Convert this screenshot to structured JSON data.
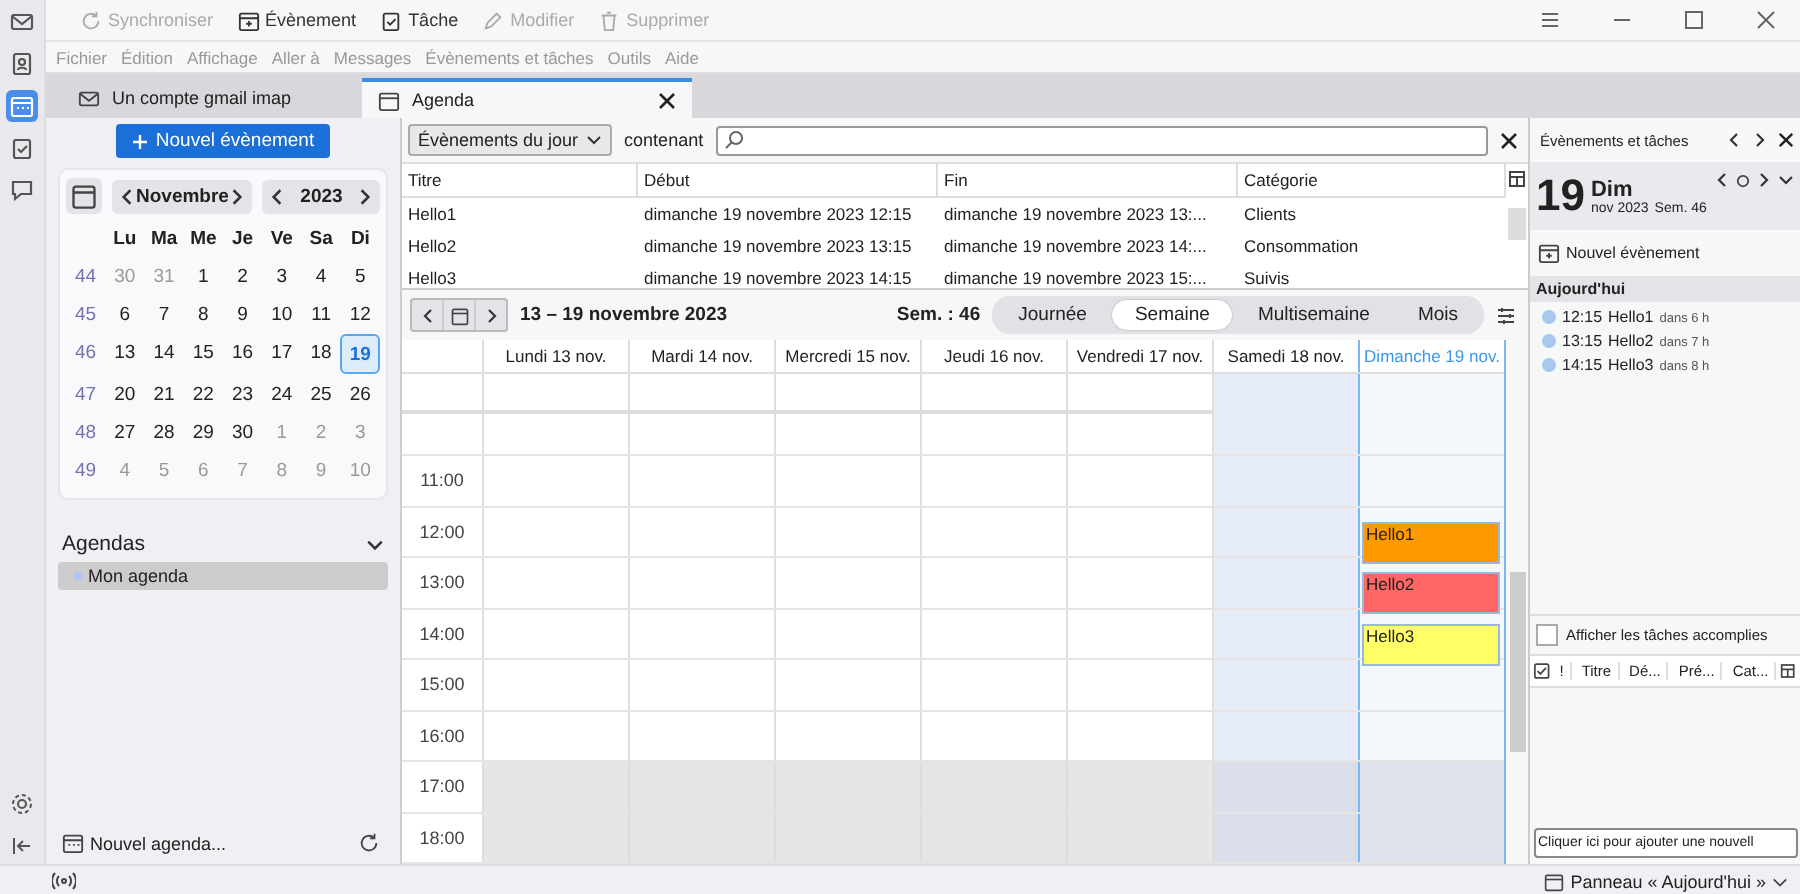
{
  "toolbar": [
    {
      "label": "Synchroniser",
      "disabled": true
    },
    {
      "label": "Évènement",
      "disabled": false
    },
    {
      "label": "Tâche",
      "disabled": false
    },
    {
      "label": "Modifier",
      "disabled": true
    },
    {
      "label": "Supprimer",
      "disabled": true
    }
  ],
  "menu": [
    "Fichier",
    "Édition",
    "Affichage",
    "Aller à",
    "Messages",
    "Évènements et tâches",
    "Outils",
    "Aide"
  ],
  "spaces": [
    {
      "selected": false
    },
    {
      "selected": false
    },
    {
      "selected": true
    },
    {
      "selected": false
    },
    {
      "selected": false
    }
  ],
  "tabs": [
    {
      "label": "Un compte gmail imap",
      "selected": false
    },
    {
      "label": "Agenda",
      "selected": true
    }
  ],
  "new_event_button": "Nouvel évènement",
  "mini_calendar": {
    "month": "Novembre",
    "year": "2023",
    "weekdays": [
      "Lu",
      "Ma",
      "Me",
      "Je",
      "Ve",
      "Sa",
      "Di"
    ],
    "weeks": [
      {
        "number": "44",
        "days": [
          {
            "label": "30",
            "other_month": true,
            "selected": false
          },
          {
            "label": "31",
            "other_month": true,
            "selected": false
          },
          {
            "label": "1",
            "other_month": false,
            "selected": false
          },
          {
            "label": "2",
            "other_month": false,
            "selected": false
          },
          {
            "label": "3",
            "other_month": false,
            "selected": false
          },
          {
            "label": "4",
            "other_month": false,
            "selected": false
          },
          {
            "label": "5",
            "other_month": false,
            "selected": false
          }
        ]
      },
      {
        "number": "45",
        "days": [
          {
            "label": "6",
            "other_month": false,
            "selected": false
          },
          {
            "label": "7",
            "other_month": false,
            "selected": false
          },
          {
            "label": "8",
            "other_month": false,
            "selected": false
          },
          {
            "label": "9",
            "other_month": false,
            "selected": false
          },
          {
            "label": "10",
            "other_month": false,
            "selected": false
          },
          {
            "label": "11",
            "other_month": false,
            "selected": false
          },
          {
            "label": "12",
            "other_month": false,
            "selected": false
          }
        ]
      },
      {
        "number": "46",
        "days": [
          {
            "label": "13",
            "other_month": false,
            "selected": false
          },
          {
            "label": "14",
            "other_month": false,
            "selected": false
          },
          {
            "label": "15",
            "other_month": false,
            "selected": false
          },
          {
            "label": "16",
            "other_month": false,
            "selected": false
          },
          {
            "label": "17",
            "other_month": false,
            "selected": false
          },
          {
            "label": "18",
            "other_month": false,
            "selected": false
          },
          {
            "label": "19",
            "other_month": false,
            "selected": true
          }
        ]
      },
      {
        "number": "47",
        "days": [
          {
            "label": "20",
            "other_month": false,
            "selected": false
          },
          {
            "label": "21",
            "other_month": false,
            "selected": false
          },
          {
            "label": "22",
            "other_month": false,
            "selected": false
          },
          {
            "label": "23",
            "other_month": false,
            "selected": false
          },
          {
            "label": "24",
            "other_month": false,
            "selected": false
          },
          {
            "label": "25",
            "other_month": false,
            "selected": false
          },
          {
            "label": "26",
            "other_month": false,
            "selected": false
          }
        ]
      },
      {
        "number": "48",
        "days": [
          {
            "label": "27",
            "other_month": false,
            "selected": false
          },
          {
            "label": "28",
            "other_month": false,
            "selected": false
          },
          {
            "label": "29",
            "other_month": false,
            "selected": false
          },
          {
            "label": "30",
            "other_month": false,
            "selected": false
          },
          {
            "label": "1",
            "other_month": true,
            "selected": false
          },
          {
            "label": "2",
            "other_month": true,
            "selected": false
          },
          {
            "label": "3",
            "other_month": true,
            "selected": false
          }
        ]
      },
      {
        "number": "49",
        "days": [
          {
            "label": "4",
            "other_month": true,
            "selected": false
          },
          {
            "label": "5",
            "other_month": true,
            "selected": false
          },
          {
            "label": "6",
            "other_month": true,
            "selected": false
          },
          {
            "label": "7",
            "other_month": true,
            "selected": false
          },
          {
            "label": "8",
            "other_month": true,
            "selected": false
          },
          {
            "label": "9",
            "other_month": true,
            "selected": false
          },
          {
            "label": "10",
            "other_month": true,
            "selected": false
          }
        ]
      }
    ]
  },
  "agendas": {
    "title": "Agendas",
    "items": [
      {
        "label": "Mon agenda",
        "selected": true,
        "color": "#a8c8f0"
      }
    ],
    "new_button": "Nouvel agenda..."
  },
  "filter": {
    "dropdown": "Évènements du jour",
    "label": "contenant"
  },
  "event_list": {
    "columns": [
      "Titre",
      "Début",
      "Fin",
      "Catégorie"
    ],
    "rows": [
      [
        "Hello1",
        "dimanche 19 novembre 2023 12:15",
        "dimanche 19 novembre 2023 13:...",
        "Clients"
      ],
      [
        "Hello2",
        "dimanche 19 novembre 2023 13:15",
        "dimanche 19 novembre 2023 14:...",
        "Consommation"
      ],
      [
        "Hello3",
        "dimanche 19 novembre 2023 14:15",
        "dimanche 19 novembre 2023 15:...",
        "Suivis"
      ]
    ]
  },
  "week_view": {
    "range": "13 – 19 novembre 2023",
    "week_label": "Sem. : 46",
    "views": [
      {
        "label": "Journée",
        "selected": false
      },
      {
        "label": "Semaine",
        "selected": true
      },
      {
        "label": "Multisemaine",
        "selected": false
      },
      {
        "label": "Mois",
        "selected": false
      }
    ],
    "days": [
      {
        "label": "Lundi 13 nov.",
        "weekend": false,
        "today": false
      },
      {
        "label": "Mardi 14 nov.",
        "weekend": false,
        "today": false
      },
      {
        "label": "Mercredi 15 nov.",
        "weekend": false,
        "today": false
      },
      {
        "label": "Jeudi 16 nov.",
        "weekend": false,
        "today": false
      },
      {
        "label": "Vendredi 17 nov.",
        "weekend": false,
        "today": false
      },
      {
        "label": "Samedi 18 nov.",
        "weekend": true,
        "today": false
      },
      {
        "label": "Dimanche 19 nov.",
        "weekend": true,
        "today": true
      }
    ],
    "hours": [
      {
        "off_hours": false
      },
      {
        "label": "11:00",
        "off_hours": false
      },
      {
        "label": "12:00",
        "off_hours": false,
        "events": [
          {
            "title": "Hello1",
            "color": "#ff9900"
          }
        ]
      },
      {
        "label": "13:00",
        "off_hours": false,
        "events": [
          {
            "title": "Hello2",
            "color": "#ff6666"
          }
        ]
      },
      {
        "label": "14:00",
        "off_hours": false,
        "events": [
          {
            "title": "Hello3",
            "color": "#ffff66"
          }
        ]
      },
      {
        "label": "15:00",
        "off_hours": false
      },
      {
        "label": "16:00",
        "off_hours": false
      },
      {
        "label": "17:00",
        "off_hours": true
      },
      {
        "label": "18:00",
        "off_hours": true
      }
    ]
  },
  "today_pane": {
    "title": "Évènements et tâches",
    "day_number": "19",
    "day_name": "Dim",
    "month_year": "nov 2023",
    "week": "Sem. 46",
    "new_event": "Nouvel évènement",
    "section": "Aujourd'hui",
    "items": [
      {
        "time": "12:15",
        "title": "Hello1",
        "relative": "dans 6 h",
        "color": "#a8c8f0"
      },
      {
        "time": "13:15",
        "title": "Hello2",
        "relative": "dans 7 h",
        "color": "#a8c8f0"
      },
      {
        "time": "14:15",
        "title": "Hello3",
        "relative": "dans 8 h",
        "color": "#a8c8f0"
      }
    ],
    "show_completed": {
      "label": "Afficher les tâches accomplies",
      "checked": false
    },
    "task_columns": [
      "!",
      "Titre",
      "Dé...",
      "Pré...",
      "Cat..."
    ],
    "new_task_placeholder": "Cliquer ici pour ajouter une nouvell",
    "status": "Panneau « Aujourd'hui »"
  }
}
